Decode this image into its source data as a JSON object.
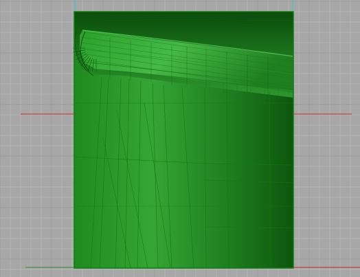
{
  "viewport": {
    "name": "cad-perspective-viewport",
    "colors": {
      "background": "#a7a7a7",
      "grid_minor": "#b5b5b5",
      "grid_major": "#9b9b9b",
      "x_axis": "#c62828",
      "y_axis": "#2e8b2e",
      "selection_edge": "#30c8d8",
      "model_fill_light": "#3aa83a",
      "model_fill_dark": "#0f5e10",
      "wire": "#0b7f0b"
    },
    "model": {
      "name": "shaded-hull-surface",
      "display_mode": "shaded-with-wireframe",
      "selected": true
    }
  }
}
